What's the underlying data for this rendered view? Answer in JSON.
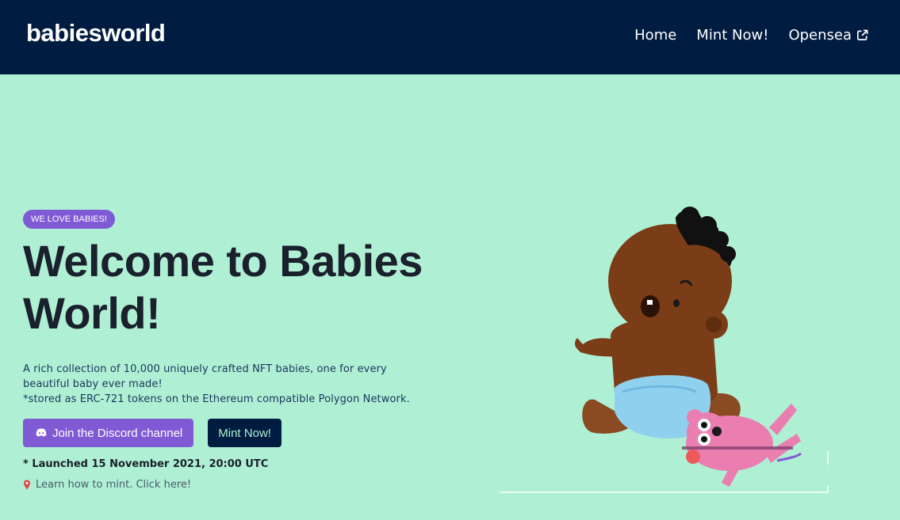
{
  "nav": {
    "brand": "babiesworld",
    "links": [
      {
        "label": "Home"
      },
      {
        "label": "Mint Now!"
      },
      {
        "label": "Opensea"
      }
    ]
  },
  "hero": {
    "badge": "WE LOVE BABIES!",
    "title": "Welcome to Babies World!",
    "description_line1": "A rich collection of 10,000 uniquely crafted NFT babies, one for every beautiful baby ever made!",
    "description_line2": "*stored as ERC-721 tokens on the Ethereum compatible Polygon Network.",
    "discord_button": "Join the Discord channel",
    "mint_button": "Mint Now!",
    "launched": "* Launched 15 November 2021, 20:00 UTC",
    "learn_link": "Learn how to mint. Click here!"
  },
  "icons": {
    "external": "external-link-icon",
    "discord": "discord-icon",
    "pin": "map-pin-icon"
  },
  "colors": {
    "navbar": "#001c40",
    "background": "#aff0d4",
    "accent": "#805ad5",
    "title": "#1a202c"
  }
}
